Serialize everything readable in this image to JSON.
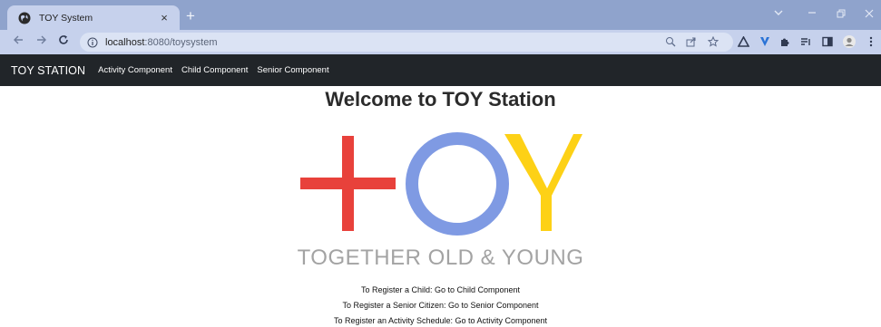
{
  "browser": {
    "tab_title": "TOY System",
    "tab_close": "×",
    "new_tab": "+",
    "url_host": "localhost",
    "url_path": ":8080/toysystem",
    "icons": [
      "back-arrow-icon",
      "forward-arrow-icon",
      "reload-icon",
      "info-icon",
      "zoom-icon",
      "share-icon",
      "bookmark-star-icon",
      "extension-icons",
      "side-panel-icon",
      "profile-avatar-icon",
      "menu-kebab-icon"
    ]
  },
  "navbar": {
    "brand": "TOY STATION",
    "links": [
      "Activity Component",
      "Child Component",
      "Senior Component"
    ]
  },
  "main": {
    "title": "Welcome to TOY Station",
    "logo": {
      "letters": [
        "+",
        "O",
        "Y"
      ],
      "colors": {
        "plus": "#e8413b",
        "o": "#7f9ae3",
        "y": "#fdd116"
      }
    },
    "tagline": "TOGETHER OLD & YOUNG",
    "instructions": [
      "To Register a Child: Go to Child Component",
      "To Register a Senior Citizen: Go to Senior Component",
      "To Register an Activity Schedule: Go to Activity Component"
    ]
  },
  "colors": {
    "titlebar": "#8fa3cc",
    "toolbar": "#c6d1ec",
    "navbar": "#212529"
  }
}
